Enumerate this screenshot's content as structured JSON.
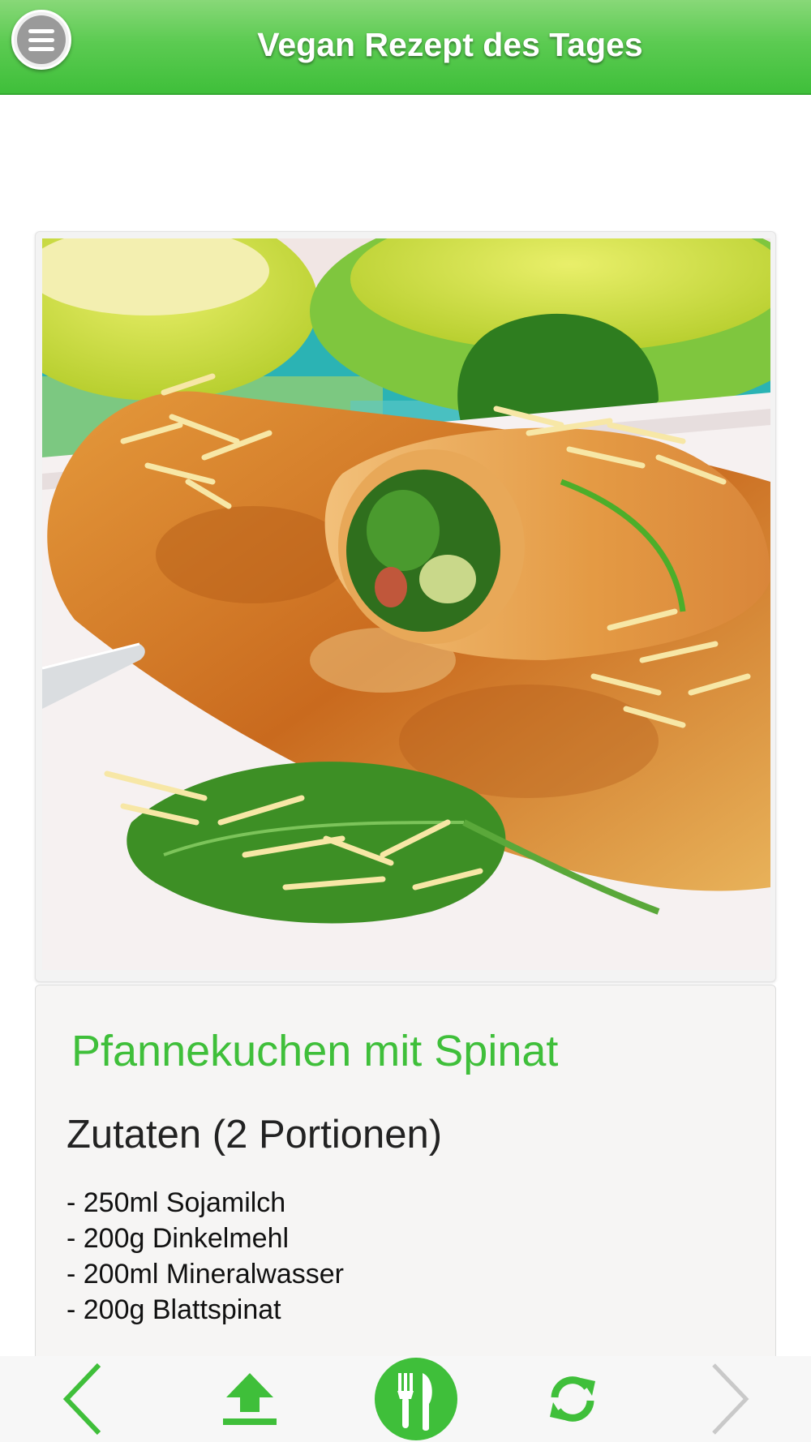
{
  "header": {
    "title": "Vegan Rezept des Tages",
    "menu_icon": "hamburger-menu-icon"
  },
  "photo": {
    "subject": "spinach-pancake-photo"
  },
  "recipe": {
    "title": "Pfannekuchen mit Spinat",
    "ingredients_heading": "Zutaten (2 Portionen)",
    "ingredients": [
      "- 250ml Sojamilch",
      "- 200g Dinkelmehl",
      "- 200ml Mineralwasser",
      "- 200g Blattspinat"
    ]
  },
  "toolbar": {
    "icons": [
      "chevron-left-icon",
      "upload-icon",
      "fork-knife-icon",
      "refresh-icon",
      "chevron-right-icon"
    ]
  },
  "colors": {
    "accent": "#3fbf3a",
    "header_top": "#88d878",
    "disabled": "#c9c9c9"
  }
}
